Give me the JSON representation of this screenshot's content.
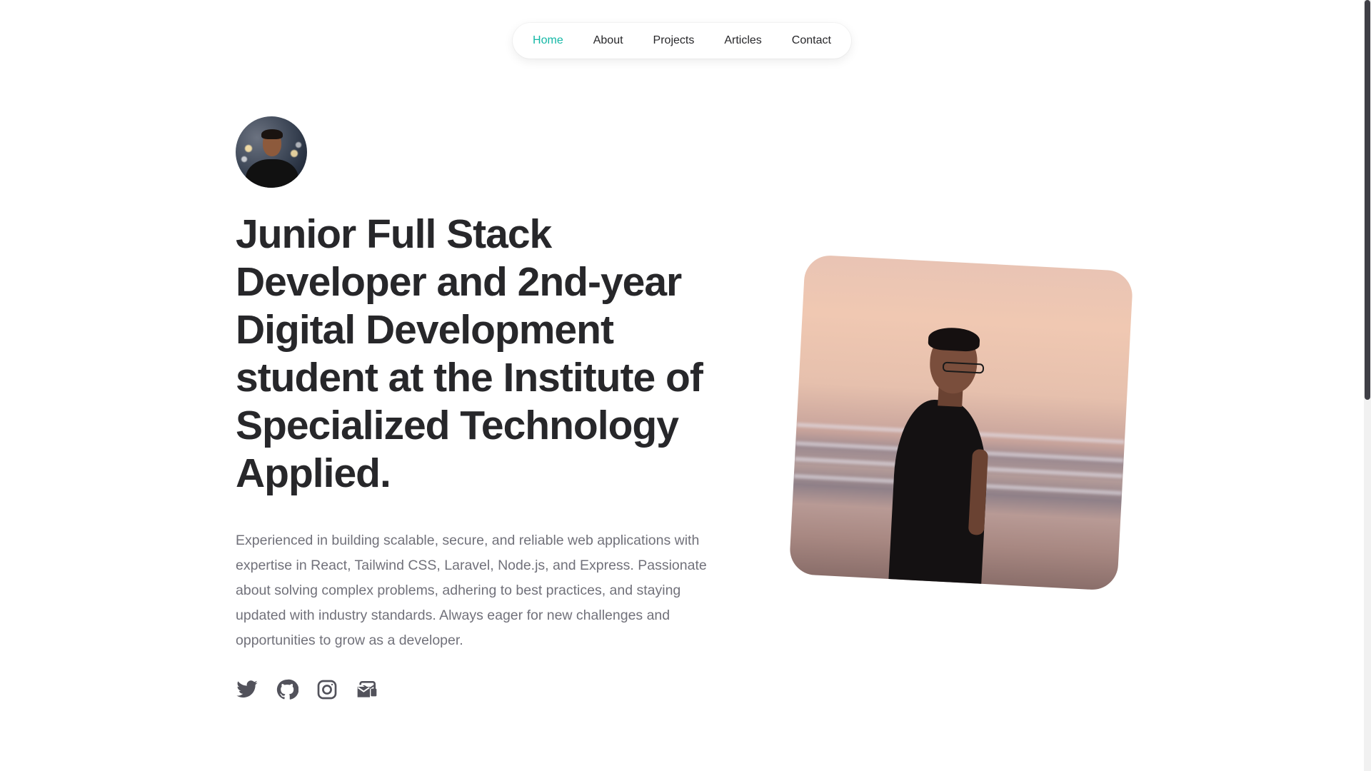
{
  "nav": {
    "items": [
      {
        "label": "Home",
        "active": true
      },
      {
        "label": "About",
        "active": false
      },
      {
        "label": "Projects",
        "active": false
      },
      {
        "label": "Articles",
        "active": false
      },
      {
        "label": "Contact",
        "active": false
      }
    ]
  },
  "hero": {
    "avatar_icon": "avatar-photo",
    "headline": "Junior Full Stack Developer and 2nd-year Digital Development student at the Institute of Specialized Technology Applied.",
    "description": "Experienced in building scalable, secure, and reliable web applications with expertise in React, Tailwind CSS, Laravel, Node.js, and Express. Passionate about solving complex problems, adhering to best practices, and staying updated with industry standards. Always eager for new challenges and opportunities to grow as a developer."
  },
  "social": {
    "icons": [
      "twitter-icon",
      "github-icon",
      "instagram-icon",
      "mail-icon"
    ]
  },
  "colors": {
    "accent": "#14b8a6",
    "text_primary": "#27272a",
    "text_secondary": "#71717a",
    "icon": "#52525b"
  }
}
